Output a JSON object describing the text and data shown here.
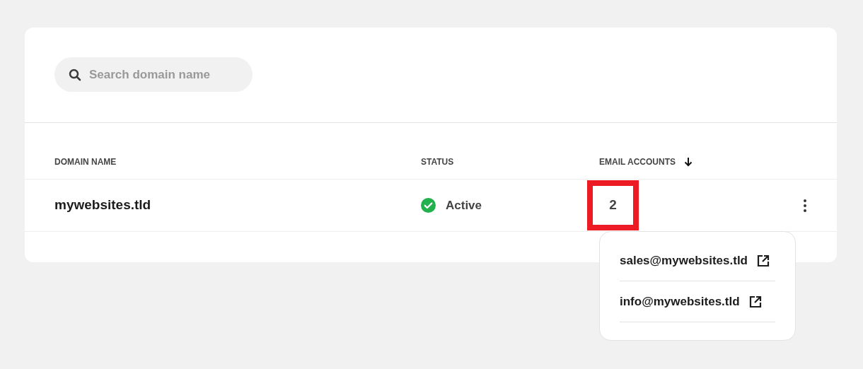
{
  "search": {
    "placeholder": "Search domain name"
  },
  "table": {
    "columns": [
      {
        "label": "DOMAIN NAME",
        "sorted": false
      },
      {
        "label": "STATUS",
        "sorted": false
      },
      {
        "label": "EMAIL ACCOUNTS",
        "sorted": true
      }
    ],
    "rows": [
      {
        "domain": "mywebsites.tld",
        "status": {
          "kind": "active",
          "label": "Active"
        },
        "email_count": "2",
        "highlighted": true
      }
    ]
  },
  "popover": {
    "emails": [
      "sales@mywebsites.tld",
      "info@mywebsites.tld"
    ]
  }
}
